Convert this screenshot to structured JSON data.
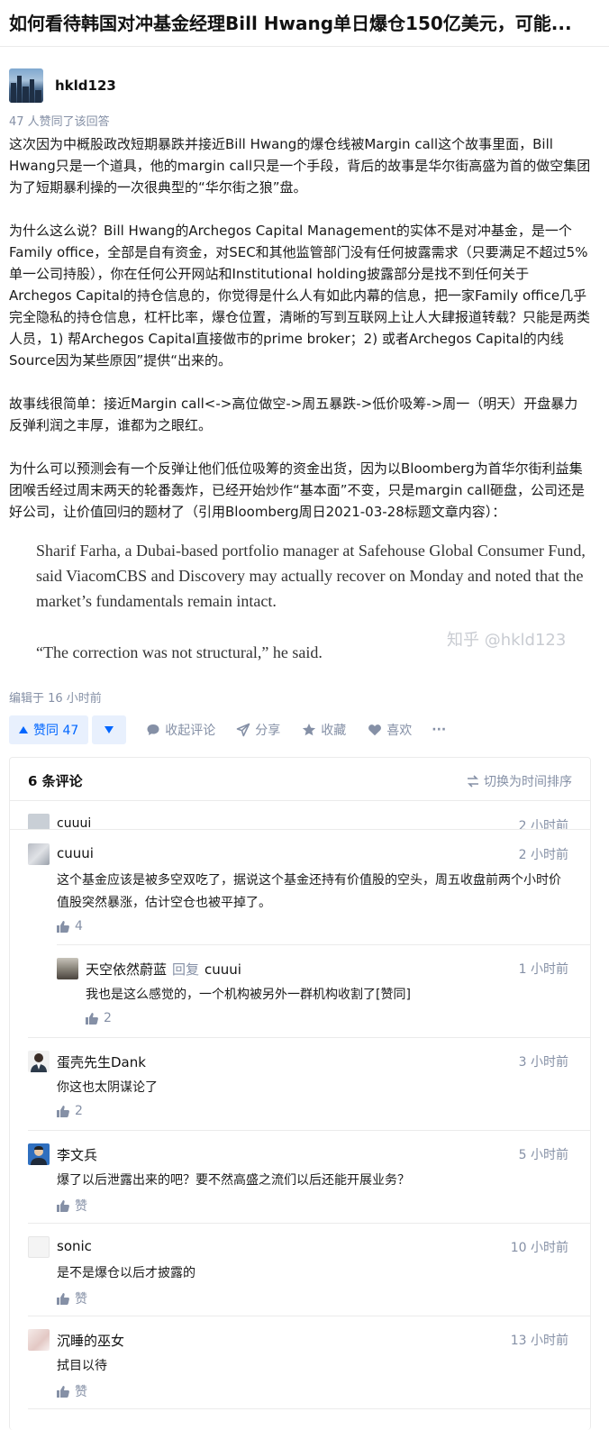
{
  "question": {
    "title": "如何看待韩国对冲基金经理Bill Hwang单日爆仓150亿美元，可能..."
  },
  "answer": {
    "author": "hkld123",
    "vote_summary": "47 人赞同了该回答",
    "paragraphs": [
      "这次因为中概股政改短期暴跌并接近Bill Hwang的爆仓线被Margin call这个故事里面，Bill Hwang只是一个道具，他的margin call只是一个手段，背后的故事是华尔街高盛为首的做空集团为了短期暴利操的一次很典型的“华尔街之狼”盘。",
      "为什么这么说？Bill Hwang的Archegos Capital Management的实体不是对冲基金，是一个Family office，全部是自有资金，对SEC和其他监管部门没有任何披露需求（只要满足不超过5%单一公司持股），你在任何公开网站和Institutional holding披露部分是找不到任何关于Archegos Capital的持仓信息的，你觉得是什么人有如此内幕的信息，把一家Family office几乎完全隐私的持仓信息，杠杆比率，爆仓位置，清晰的写到互联网上让人大肆报道转载？只能是两类人员，1) 帮Archegos Capital直接做市的prime broker；2) 或者Archegos Capital的内线Source因为某些原因”提供“出来的。",
      "故事线很简单：接近Margin call<->高位做空->周五暴跌->低价吸筹->周一（明天）开盘暴力反弹利润之丰厚，谁都为之眼红。",
      "为什么可以预测会有一个反弹让他们低位吸筹的资金出货，因为以Bloomberg为首华尔街利益集团喉舌经过周末两天的轮番轰炸，已经开始炒作“基本面”不变，只是margin call砸盘，公司还是好公司，让价值回归的题材了（引用Bloomberg周日2021-03-28标题文章内容）："
    ],
    "quote": [
      "Sharif Farha, a Dubai-based portfolio manager at Safehouse Global Consumer Fund, said ViacomCBS and Discovery may actually recover on Monday and noted that the market’s fundamentals remain intact.",
      "“The correction was not structural,” he said."
    ],
    "watermark": "知乎 @hkld123",
    "edited": "编辑于 16 小时前",
    "actions": {
      "upvote": "赞同 47",
      "collapse_comments": "收起评论",
      "share": "分享",
      "favorite": "收藏",
      "like": "喜欢",
      "more": "···"
    }
  },
  "comments": {
    "count_label": "6 条评论",
    "sort_label": "切换为时间排序",
    "ghost": {
      "name": "cuuui",
      "time": "2 小时前"
    },
    "items": [
      {
        "name": "cuuui",
        "time": "2 小时前",
        "text": "这个基金应该是被多空双吃了，据说这个基金还持有价值股的空头，周五收盘前两个小时价值股突然暴涨，估计空仓也被平掉了。",
        "likes": "4"
      },
      {
        "name": "蛋壳先生Dank",
        "time": "3 小时前",
        "text": "你这也太阴谋论了",
        "likes": "2"
      },
      {
        "name": "李文兵",
        "time": "5 小时前",
        "text": "爆了以后泄露出来的吧？要不然高盛之流们以后还能开展业务？",
        "likes": "赞"
      },
      {
        "name": "sonic",
        "time": "10 小时前",
        "text": "是不是爆仓以后才披露的",
        "likes": "赞"
      },
      {
        "name": "沉睡的巫女",
        "time": "13 小时前",
        "text": "拭目以待",
        "likes": "赞"
      }
    ],
    "reply": {
      "name": "天空依然蔚蓝",
      "reply_word": "回复",
      "target": "cuuui",
      "time": "1 小时前",
      "text": "我也是这么感觉的，一个机构被另外一群机构收割了[赞同]",
      "likes": "2"
    }
  }
}
